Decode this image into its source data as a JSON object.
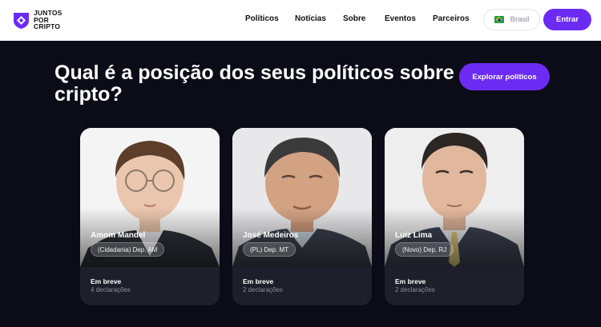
{
  "header": {
    "logo": {
      "line1": "JUNTOS",
      "line2": "POR",
      "line3": "CRIPTO"
    },
    "nav": [
      "Políticos",
      "Notícias",
      "Sobre",
      "Eventos",
      "Parceiros"
    ],
    "language": {
      "label": "Brasil",
      "flag_icon": "brazil-flag-icon"
    },
    "enter_label": "Entrar"
  },
  "hero": {
    "title": "Qual é a posição dos seus políticos sobre cripto?",
    "explore_label": "Explorar políticos"
  },
  "cards": [
    {
      "name": "Amom Mandel",
      "party": "(Cidadania) Dep. AM",
      "status": "Em breve",
      "declarations": "4 declarações"
    },
    {
      "name": "José Medeiros",
      "party": "(PL) Dep. MT",
      "status": "Em breve",
      "declarations": "2 declarações"
    },
    {
      "name": "Luiz Lima",
      "party": "(Novo) Dep. RJ",
      "status": "Em breve",
      "declarations": "2 declarações"
    }
  ],
  "colors": {
    "accent": "#6b2bf3",
    "background": "#0b0c17",
    "card": "#1e1f2a"
  }
}
